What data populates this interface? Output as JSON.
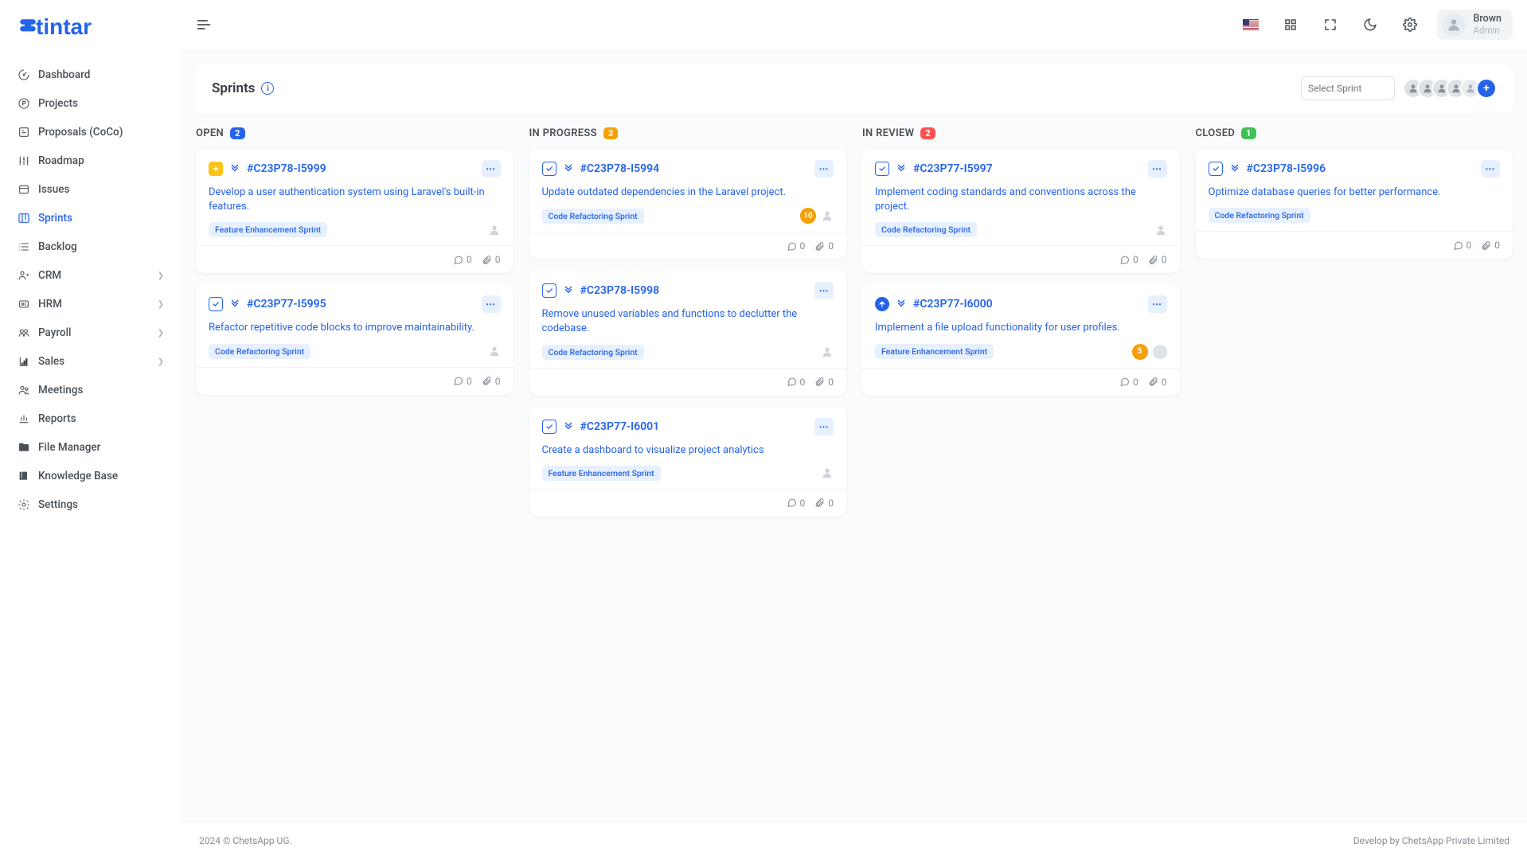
{
  "brand": "tintar",
  "user": {
    "name": "Brown",
    "role": "Admin"
  },
  "header": {
    "title": "Sprints",
    "select_placeholder": "Select Sprint"
  },
  "nav": [
    {
      "label": "Dashboard",
      "icon": "gauge",
      "expandable": false
    },
    {
      "label": "Projects",
      "icon": "circle-p",
      "expandable": false
    },
    {
      "label": "Proposals (CoCo)",
      "icon": "proposal",
      "expandable": false
    },
    {
      "label": "Roadmap",
      "icon": "roadmap",
      "expandable": false
    },
    {
      "label": "Issues",
      "icon": "issues",
      "expandable": false
    },
    {
      "label": "Sprints",
      "icon": "board",
      "expandable": false,
      "active": true
    },
    {
      "label": "Backlog",
      "icon": "backlog",
      "expandable": false
    },
    {
      "label": "CRM",
      "icon": "crm",
      "expandable": true
    },
    {
      "label": "HRM",
      "icon": "hrm",
      "expandable": true
    },
    {
      "label": "Payroll",
      "icon": "payroll",
      "expandable": true
    },
    {
      "label": "Sales",
      "icon": "sales",
      "expandable": true
    },
    {
      "label": "Meetings",
      "icon": "meetings",
      "expandable": false
    },
    {
      "label": "Reports",
      "icon": "reports",
      "expandable": false
    },
    {
      "label": "File Manager",
      "icon": "folder",
      "expandable": false
    },
    {
      "label": "Knowledge Base",
      "icon": "book",
      "expandable": false
    },
    {
      "label": "Settings",
      "icon": "gear",
      "expandable": false
    }
  ],
  "columns": [
    {
      "title": "OPEN",
      "count": "2",
      "badge_class": "blue",
      "cards": [
        {
          "type": "feature",
          "id": "#C23P78-I5999",
          "title": "Develop a user authentication system using Laravel's built-in features.",
          "tags": [
            "Feature Enhancement Sprint"
          ],
          "points": null,
          "assignees": 0,
          "comments": "0",
          "attachments": "0"
        },
        {
          "type": "task",
          "id": "#C23P77-I5995",
          "title": "Refactor repetitive code blocks to improve maintainability.",
          "tags": [
            "Code Refactoring Sprint"
          ],
          "points": null,
          "assignees": 0,
          "comments": "0",
          "attachments": "0"
        }
      ]
    },
    {
      "title": "IN PROGRESS",
      "count": "3",
      "badge_class": "orange",
      "cards": [
        {
          "type": "task",
          "id": "#C23P78-I5994",
          "title": "Update outdated dependencies in the Laravel project.",
          "tags": [
            "Code Refactoring Sprint"
          ],
          "points": "10",
          "assignees": 0,
          "comments": "0",
          "attachments": "0"
        },
        {
          "type": "task",
          "id": "#C23P78-I5998",
          "title": "Remove unused variables and functions to declutter the codebase.",
          "tags": [
            "Code Refactoring Sprint"
          ],
          "points": null,
          "assignees": 0,
          "comments": "0",
          "attachments": "0"
        },
        {
          "type": "task",
          "id": "#C23P77-I6001",
          "title": "Create a dashboard to visualize project analytics",
          "tags": [
            "Feature Enhancement Sprint"
          ],
          "points": null,
          "assignees": 0,
          "comments": "0",
          "attachments": "0"
        }
      ]
    },
    {
      "title": "IN REVIEW",
      "count": "2",
      "badge_class": "red",
      "cards": [
        {
          "type": "task",
          "id": "#C23P77-I5997",
          "title": "Implement coding standards and conventions across the project.",
          "tags": [
            "Code Refactoring Sprint"
          ],
          "points": null,
          "assignees": 0,
          "comments": "0",
          "attachments": "0"
        },
        {
          "type": "story",
          "id": "#C23P77-I6000",
          "title": "Implement a file upload functionality for user profiles.",
          "tags": [
            "Feature Enhancement Sprint"
          ],
          "points": "5",
          "assignees": 1,
          "comments": "0",
          "attachments": "0"
        }
      ]
    },
    {
      "title": "CLOSED",
      "count": "1",
      "badge_class": "green",
      "cards": [
        {
          "type": "task",
          "id": "#C23P78-I5996",
          "title": "Optimize database queries for better performance.",
          "tags": [
            "Code Refactoring Sprint"
          ],
          "points": null,
          "assignees": null,
          "comments": "0",
          "attachments": "0"
        }
      ]
    }
  ],
  "footer": {
    "left": "2024 © ChetsApp UG.",
    "right": "Develop by ChetsApp Private Limited"
  }
}
